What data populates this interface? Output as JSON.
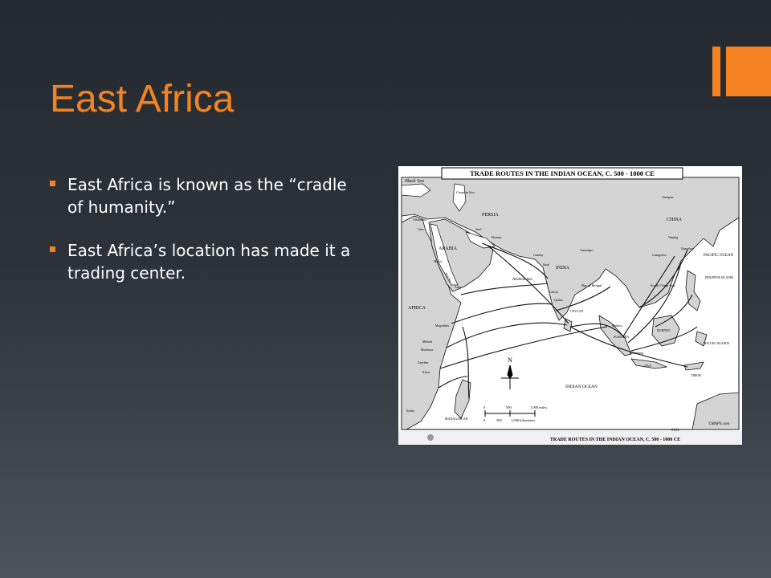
{
  "slide": {
    "title": "East Africa",
    "bullets": [
      "East Africa is known as the “cradle of humanity.”",
      "East Africa’s location has made it a trading center."
    ],
    "accent_color": "#f58220"
  },
  "map": {
    "header": "TRADE ROUTES IN THE INDIAN OCEAN, C. 500 - 1000 CE",
    "footer": "TRADE ROUTES IN THE INDIAN OCEAN, C. 500 - 1000 CE",
    "map_number": "#121",
    "credit": "©MAPS.com",
    "compass_label": "N",
    "scale_miles": [
      "0",
      "500",
      "1,000 miles"
    ],
    "scale_km": [
      "0",
      "500",
      "1,000 kilometers"
    ],
    "region_labels": {
      "black_sea": "Black Sea",
      "caspian_sea": "Caspian Sea",
      "persia": "PERSIA",
      "arabia": "ARABIA",
      "africa": "AFRICA",
      "india": "INDIA",
      "china": "CHINA",
      "arabian_sea": "Arabian Sea",
      "bay_of_bengal": "Bay of Bengal",
      "south_china_sea": "South China Sea",
      "pacific_ocean": "PACIFIC OCEAN",
      "indian_ocean": "INDIAN OCEAN",
      "philippine_islands": "PHILIPPINE ISLANDS",
      "ceylon": "CEYLON",
      "madagascar": "MADAGASCAR",
      "sumatra": "SUMATRA",
      "borneo": "BORNEO",
      "java": "JAVA",
      "timor": "TIMOR",
      "maluku_islands": "MALUKU ISLANDS",
      "red_sea": "Red Sea"
    },
    "city_labels": {
      "alexandria": "Alexandria",
      "cairo": "Cairo",
      "mecca": "Mecca",
      "aden": "Aden",
      "hormuz": "Hormuz",
      "siraf": "Siraf",
      "mogadishu": "Mogadishu",
      "malindi": "Malindi",
      "mombasa": "Mombasa",
      "zanzibar": "Zanzibar",
      "kilwa": "Kilwa",
      "sofala": "Sofala",
      "calicut": "Calicut",
      "quilon": "Quilon",
      "cambay": "Cambay",
      "surat": "Surat",
      "tamralipti": "Tamralipti",
      "nanjing": "Nanjing",
      "quanzhou": "Quanzhou",
      "guangzhou": "Guangzhou",
      "malacca": "Malacca",
      "palembang": "Palembang",
      "changan": "Chang'an"
    }
  }
}
